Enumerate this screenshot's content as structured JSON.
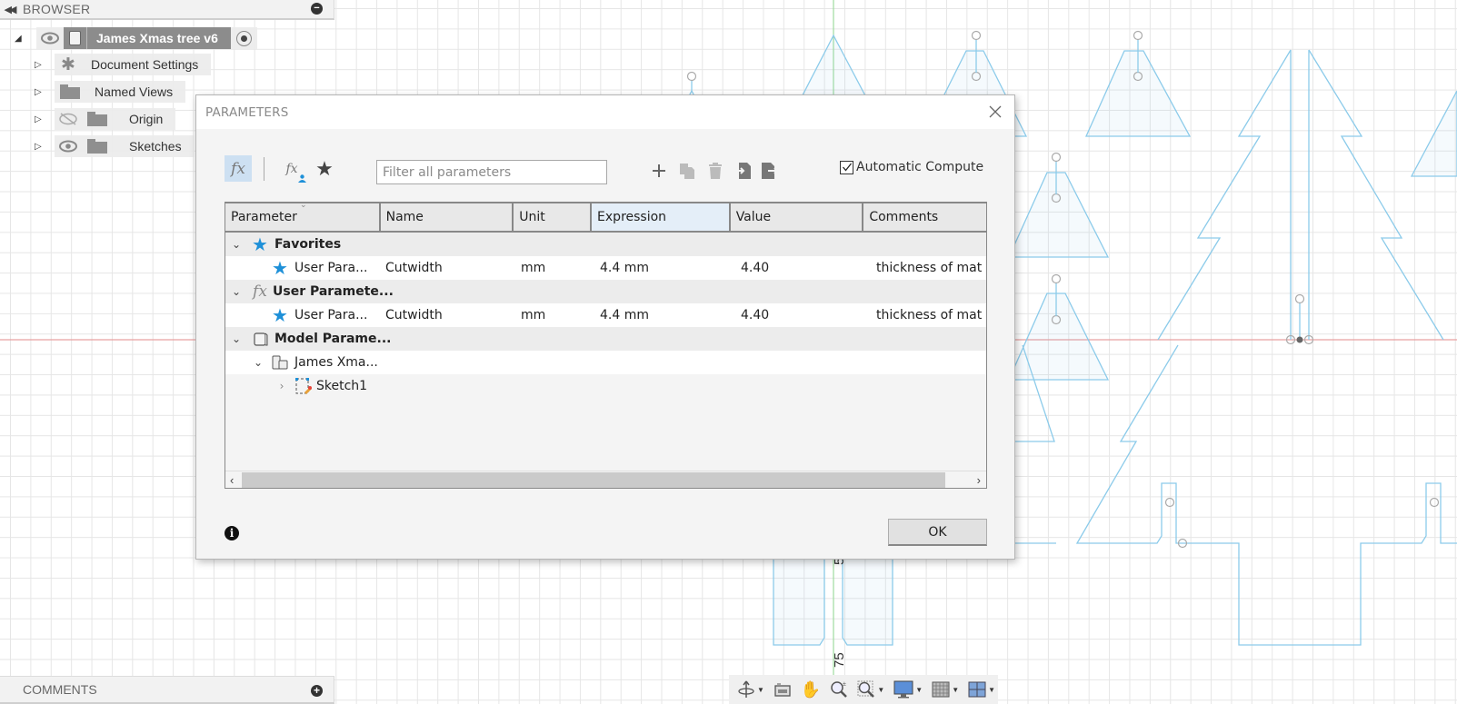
{
  "browser": {
    "title": "BROWSER",
    "root": {
      "name": "James Xmas tree v6"
    },
    "items": [
      {
        "label": "Document Settings",
        "icon": "gear-icon"
      },
      {
        "label": "Named Views",
        "icon": "folder-icon"
      },
      {
        "label": "Origin",
        "icon": "folder-icon",
        "visibility": "hidden"
      },
      {
        "label": "Sketches",
        "icon": "folder-icon",
        "visibility": "visible"
      }
    ]
  },
  "comments": {
    "title": "COMMENTS"
  },
  "canvas": {
    "dimension_labels": [
      "5",
      "75"
    ],
    "sketch_color": "#7cc3e6",
    "x_axis_color": "#e8a0a0",
    "y_axis_color": "#9fdc9f"
  },
  "nav_toolbar": {
    "tools": [
      "orbit-icon",
      "look-at-icon",
      "pan-icon",
      "zoom-icon",
      "zoom-window-icon",
      "display-settings-icon",
      "grid-icon",
      "viewports-icon"
    ]
  },
  "dialog": {
    "title": "PARAMETERS",
    "filter": {
      "placeholder": "Filter all parameters",
      "value": ""
    },
    "auto_compute": {
      "label": "Automatic Compute",
      "checked": true
    },
    "columns": [
      "Parameter",
      "Name",
      "Unit",
      "Expression",
      "Value",
      "Comments"
    ],
    "rows": [
      {
        "type": "group",
        "label": "Favorites",
        "icon": "star"
      },
      {
        "type": "item",
        "parameter": "User Para...",
        "name": "Cutwidth",
        "unit": "mm",
        "expression": "4.4 mm",
        "value": "4.40",
        "comments": "thickness of mat"
      },
      {
        "type": "group",
        "label": "User Paramete...",
        "icon": "fx"
      },
      {
        "type": "item",
        "parameter": "User Para...",
        "name": "Cutwidth",
        "unit": "mm",
        "expression": "4.4 mm",
        "value": "4.40",
        "comments": "thickness of mat"
      },
      {
        "type": "group",
        "label": "Model Parame...",
        "icon": "body"
      },
      {
        "type": "subgroup",
        "label": "James Xma...",
        "icon": "component"
      },
      {
        "type": "leaf",
        "label": "Sketch1",
        "icon": "sketch"
      }
    ],
    "ok_label": "OK"
  }
}
